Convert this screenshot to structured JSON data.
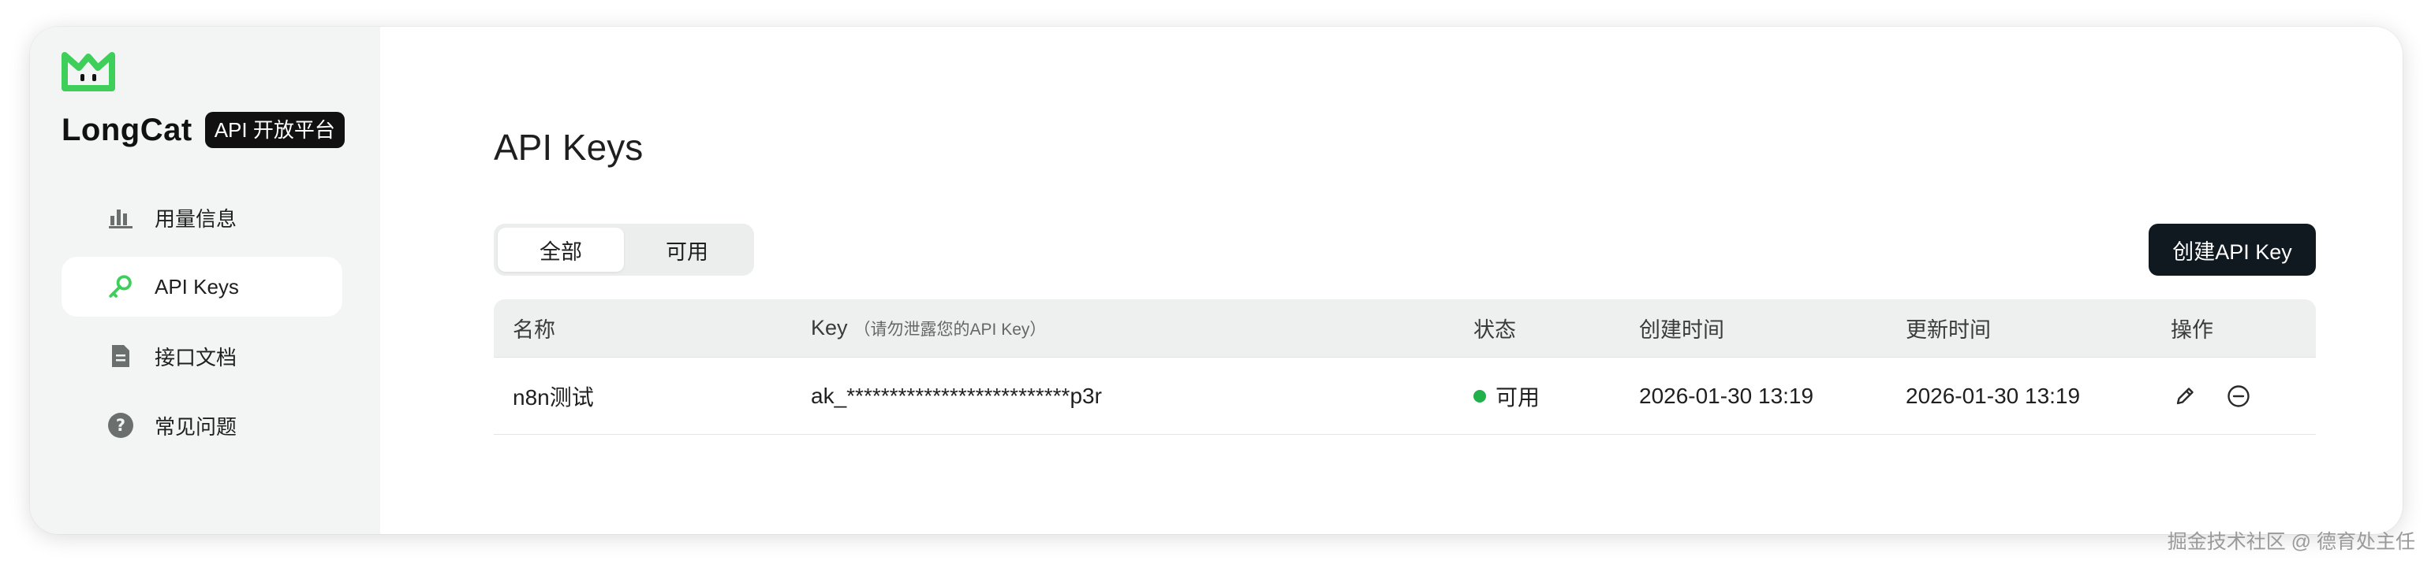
{
  "brand": {
    "name": "LongCat",
    "badge": "API 开放平台",
    "accent": "#3ecf5a"
  },
  "sidebar": {
    "items": [
      {
        "label": "用量信息",
        "icon": "bar-chart-icon",
        "active": false
      },
      {
        "label": "API Keys",
        "icon": "key-icon",
        "active": true
      },
      {
        "label": "接口文档",
        "icon": "document-icon",
        "active": false
      },
      {
        "label": "常见问题",
        "icon": "question-circle-icon",
        "active": false
      }
    ]
  },
  "main": {
    "title": "API Keys",
    "tabs": [
      {
        "label": "全部",
        "active": true
      },
      {
        "label": "可用",
        "active": false
      }
    ],
    "create_button": "创建API Key"
  },
  "table": {
    "columns": {
      "name": "名称",
      "key": "Key",
      "key_hint": "（请勿泄露您的API Key）",
      "status": "状态",
      "created": "创建时间",
      "updated": "更新时间",
      "ops": "操作"
    },
    "rows": [
      {
        "name": "n8n测试",
        "key": "ak_**************************p3r",
        "status": "可用",
        "status_color": "#22b04b",
        "created": "2026-01-30 13:19",
        "updated": "2026-01-30 13:19",
        "actions": [
          "edit-icon",
          "remove-circle-icon"
        ]
      }
    ]
  },
  "watermark": "掘金技术社区 @ 德育处主任"
}
